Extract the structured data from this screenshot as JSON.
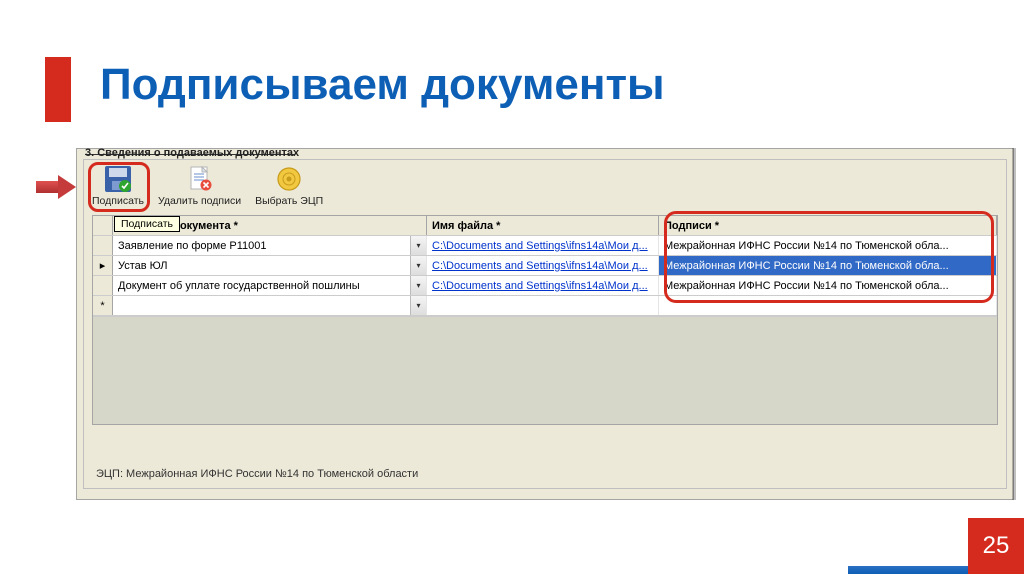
{
  "page": {
    "title": "Подписываем документы",
    "number": "25"
  },
  "section": {
    "label": "3. Сведения о подаваемых документах"
  },
  "toolbar": {
    "sign": "Подписать",
    "delete_sign": "Удалить подписи",
    "choose_ecp": "Выбрать ЭЦП",
    "tooltip": "Подписать"
  },
  "table": {
    "headers": {
      "doc_name": "Название документа *",
      "file_name": "Имя файла *",
      "signatures": "Подписи *"
    },
    "rows": [
      {
        "marker": "",
        "doc": "Заявление по форме Р11001",
        "file": "C:\\Documents and Settings\\ifns14a\\Мои д...",
        "sign": "Межрайонная ИФНС России №14 по Тюменской обла..."
      },
      {
        "marker": "▸",
        "doc": "Устав ЮЛ",
        "file": "C:\\Documents and Settings\\ifns14a\\Мои д...",
        "sign": "Межрайонная ИФНС России №14 по Тюменской обла..."
      },
      {
        "marker": "",
        "doc": "Документ об уплате государственной пошлины",
        "file": "C:\\Documents and Settings\\ifns14a\\Мои д...",
        "sign": "Межрайонная ИФНС России №14 по Тюменской обла..."
      },
      {
        "marker": "*",
        "doc": "",
        "file": "",
        "sign": ""
      }
    ]
  },
  "status": {
    "text": "ЭЦП: Межрайонная ИФНС России №14 по Тюменской области"
  }
}
